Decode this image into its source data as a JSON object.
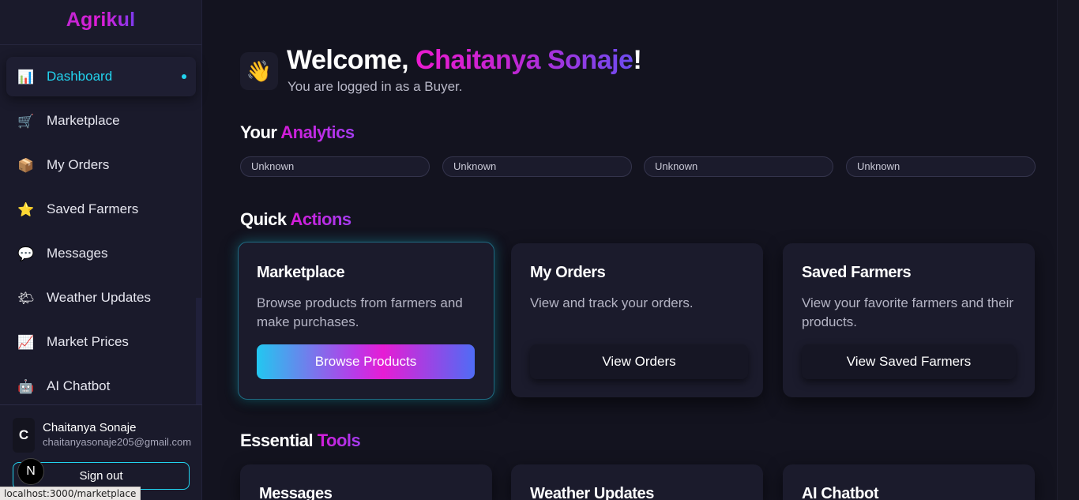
{
  "sidebar": {
    "brand": "Agrikul",
    "items": [
      {
        "label": "Dashboard",
        "icon": "📊",
        "active": true
      },
      {
        "label": "Marketplace",
        "icon": "🛒"
      },
      {
        "label": "My Orders",
        "icon": "📦"
      },
      {
        "label": "Saved Farmers",
        "icon": "⭐"
      },
      {
        "label": "Messages",
        "icon": "💬"
      },
      {
        "label": "Weather Updates",
        "icon": "🌤"
      },
      {
        "label": "Market Prices",
        "icon": "📈"
      },
      {
        "label": "AI Chatbot",
        "icon": "🤖"
      }
    ],
    "user": {
      "initial": "C",
      "name": "Chaitanya Sonaje",
      "email": "chaitanyasonaje205@gmail.com"
    },
    "signout_label": "Sign out"
  },
  "overlay": {
    "next_badge": "N",
    "status_url": "localhost:3000/marketplace"
  },
  "main": {
    "welcome_prefix": "Welcome, ",
    "welcome_name": "Chaitanya Sonaje",
    "welcome_suffix": "!",
    "wave_icon": "👋",
    "role_line": "You are logged in as a Buyer.",
    "analytics": {
      "title_plain": "Your ",
      "title_accent": "Analytics",
      "pills": [
        "Unknown",
        "Unknown",
        "Unknown",
        "Unknown"
      ]
    },
    "quick_actions": {
      "title_plain": "Quick ",
      "title_accent": "Actions",
      "cards": [
        {
          "title": "Marketplace",
          "desc": "Browse products from farmers and make purchases.",
          "button": "Browse Products"
        },
        {
          "title": "My Orders",
          "desc": "View and track your orders.",
          "button": "View Orders"
        },
        {
          "title": "Saved Farmers",
          "desc": "View your favorite farmers and their products.",
          "button": "View Saved Farmers"
        }
      ]
    },
    "essential_tools": {
      "title_plain": "Essential ",
      "title_accent": "Tools",
      "cards": [
        {
          "title": "Messages"
        },
        {
          "title": "Weather Updates"
        },
        {
          "title": "AI Chatbot"
        }
      ]
    }
  },
  "colors": {
    "background": "#13131f",
    "sidebar": "#1a1a2b",
    "accent_cyan": "#22d3ee",
    "accent_magenta": "#e11dd8",
    "accent_violet": "#6d4cf0"
  }
}
